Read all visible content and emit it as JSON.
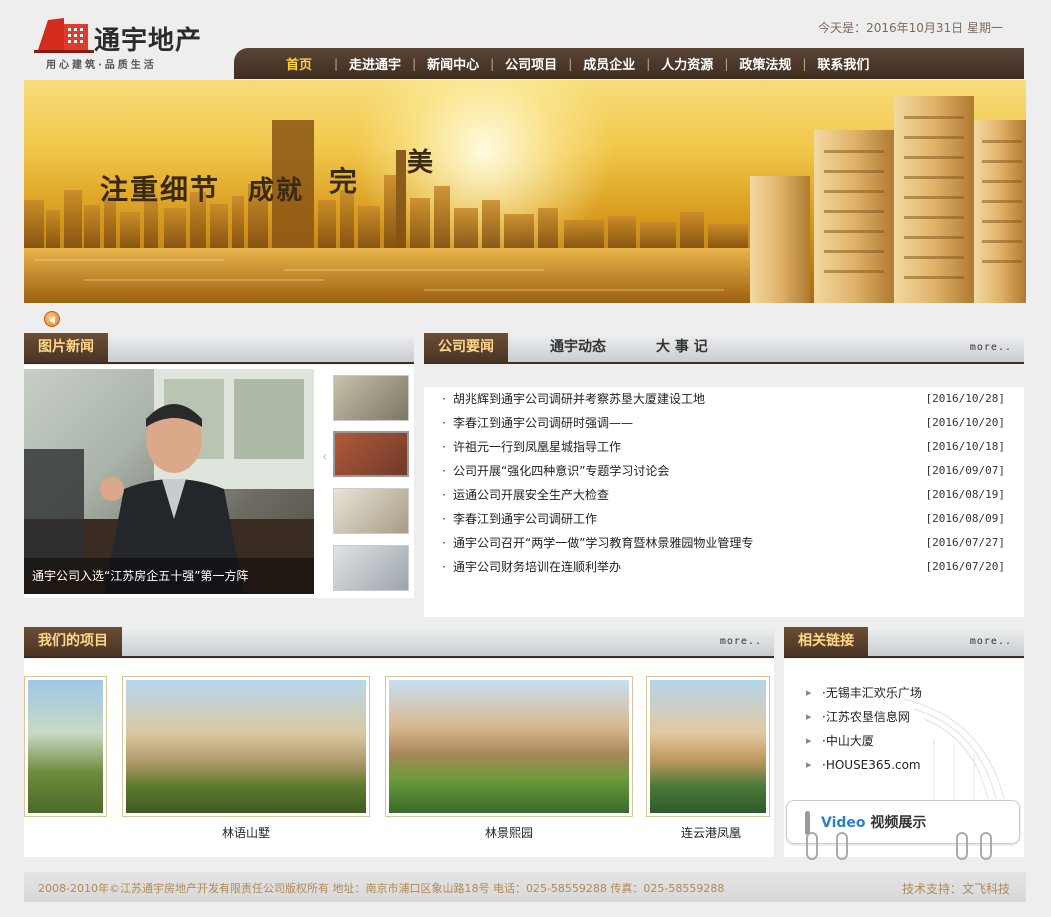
{
  "brand": {
    "name": "通宇地产",
    "slogan": "用心建筑·品质生活"
  },
  "header": {
    "date_text": "今天是：2016年10月31日  星期一"
  },
  "nav": {
    "items": [
      {
        "label": "首页",
        "active": true
      },
      {
        "label": "走进通宇"
      },
      {
        "label": "新闻中心"
      },
      {
        "label": "公司项目"
      },
      {
        "label": "成员企业"
      },
      {
        "label": "人力资源"
      },
      {
        "label": "政策法规"
      },
      {
        "label": "联系我们"
      }
    ]
  },
  "banner": {
    "headline": [
      "注重细节",
      "成就",
      "完",
      "美"
    ]
  },
  "picnews": {
    "title": "图片新闻",
    "caption": "通宇公司入选“江苏房企五十强”第一方阵"
  },
  "news": {
    "tabs": [
      "公司要闻",
      "通宇动态",
      "大 事 记"
    ],
    "more": "more..",
    "items": [
      {
        "title": "胡兆辉到通宇公司调研并考察苏垦大厦建设工地",
        "date": "[2016/10/28]"
      },
      {
        "title": "李春江到通宇公司调研时强调——",
        "date": "[2016/10/20]"
      },
      {
        "title": "许祖元一行到凤凰星城指导工作",
        "date": "[2016/10/18]"
      },
      {
        "title": "公司开展“强化四种意识”专题学习讨论会",
        "date": "[2016/09/07]"
      },
      {
        "title": "运通公司开展安全生产大检查",
        "date": "[2016/08/19]"
      },
      {
        "title": "李春江到通宇公司调研工作",
        "date": "[2016/08/09]"
      },
      {
        "title": "通宇公司召开“两学一做”学习教育暨林景雅园物业管理专",
        "date": "[2016/07/27]"
      },
      {
        "title": "通宇公司财务培训在连顺利举办",
        "date": "[2016/07/20]"
      }
    ]
  },
  "projects": {
    "title": "我们的项目",
    "more": "more..",
    "items": [
      {
        "name": "林语山墅"
      },
      {
        "name": "林景熙园"
      },
      {
        "name": "连云港凤凰"
      }
    ]
  },
  "links": {
    "title": "相关链接",
    "more": "more..",
    "items": [
      "·无锡丰汇欢乐广场",
      "·江苏农垦信息网",
      "·中山大厦",
      "·HOUSE365.com"
    ]
  },
  "video": {
    "prefix": "Video",
    "label": "视频展示"
  },
  "footer": {
    "copyright": "2008-2010年©江苏通宇房地产开发有限责任公司版权所有 地址：南京市浦口区象山路18号 电话：025-58559288 传真：025-58559288",
    "support": "技术支持：文飞科技"
  },
  "colors": {
    "nav_bg": "#3e2d22",
    "nav_active": "#ffd23b",
    "tag_text": "#ffd68a",
    "footer_text": "#b08a55"
  }
}
